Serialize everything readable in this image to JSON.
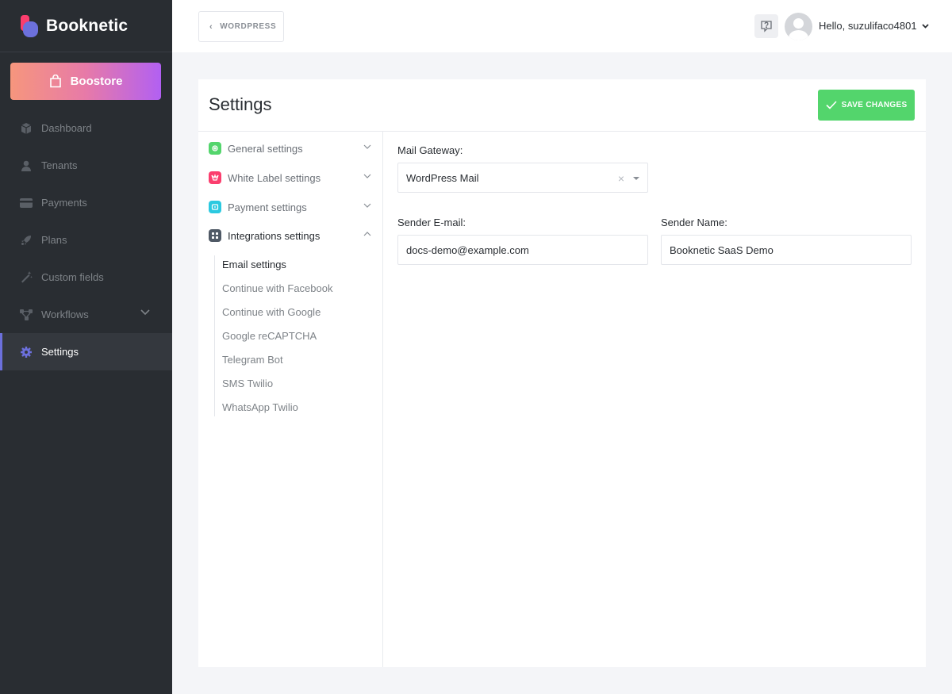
{
  "brand": {
    "name": "Booknetic"
  },
  "sidebar": {
    "boostore_label": "Boostore",
    "items": [
      {
        "label": "Dashboard",
        "icon": "cube-icon"
      },
      {
        "label": "Tenants",
        "icon": "user-icon"
      },
      {
        "label": "Payments",
        "icon": "credit-card-icon"
      },
      {
        "label": "Plans",
        "icon": "rocket-icon"
      },
      {
        "label": "Custom fields",
        "icon": "magic-wand-icon"
      },
      {
        "label": "Workflows",
        "icon": "workflow-icon"
      },
      {
        "label": "Settings",
        "icon": "gear-icon",
        "active": true
      }
    ]
  },
  "topbar": {
    "back_label": "WORDPRESS",
    "greeting": "Hello, suzulifaco4801"
  },
  "page": {
    "title": "Settings",
    "save_label": "SAVE CHANGES"
  },
  "settings_nav": {
    "sections": [
      {
        "label": "General settings",
        "color": "#53d56c"
      },
      {
        "label": "White Label settings",
        "color": "#fb3e6e"
      },
      {
        "label": "Payment settings",
        "color": "#2bc9e0"
      },
      {
        "label": "Integrations settings",
        "color": "#4f5965",
        "open": true
      }
    ],
    "subitems": [
      "Email settings",
      "Continue with Facebook",
      "Continue with Google",
      "Google reCAPTCHA",
      "Telegram Bot",
      "SMS Twilio",
      "WhatsApp Twilio"
    ]
  },
  "form": {
    "mail_gateway_label": "Mail Gateway:",
    "mail_gateway_value": "WordPress Mail",
    "sender_email_label": "Sender E-mail:",
    "sender_email_value": "docs-demo@example.com",
    "sender_name_label": "Sender Name:",
    "sender_name_value": "Booknetic SaaS Demo"
  },
  "colors": {
    "accent": "#6c70dc",
    "save": "#53d56c",
    "sidebar_bg": "#292d32"
  }
}
